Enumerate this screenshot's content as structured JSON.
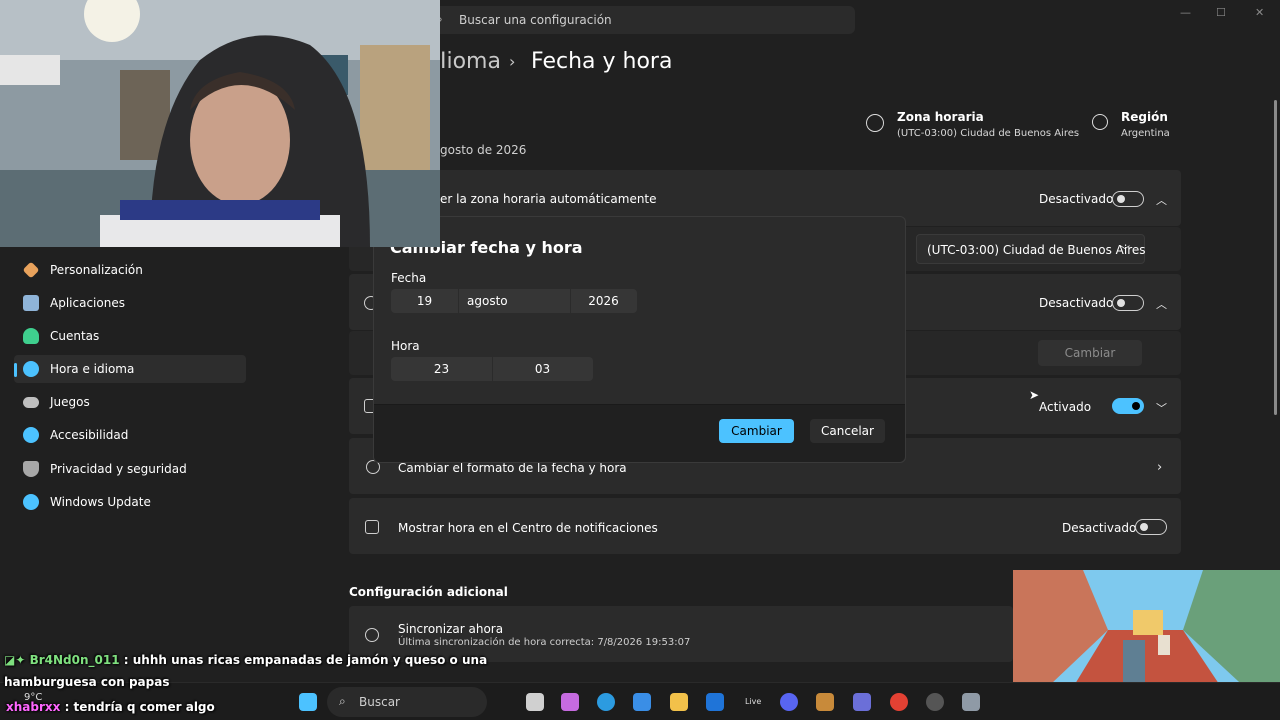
{
  "search": {
    "placeholder": "Buscar una configuración"
  },
  "window_controls": {
    "minimize": "—",
    "maximize": "☐",
    "close": "✕"
  },
  "breadcrumb": {
    "prev": "Iioma",
    "sep": "›",
    "current": "Fecha y hora"
  },
  "time_zone_info": {
    "title": "Zona horaria",
    "value": "(UTC-03:00) Ciudad de Buenos Aires"
  },
  "region_info": {
    "title": "Región",
    "value": "Argentina"
  },
  "current_date_text": "gosto de 2026",
  "settings": {
    "auto_timezone": {
      "label": "er la zona horaria automáticamente",
      "state": "Desactivado",
      "on": false
    },
    "timezone_dropdown": {
      "value": "(UTC-03:00) Ciudad de Buenos Aires"
    },
    "auto_time": {
      "state": "Desactivado",
      "on": false
    },
    "manual_change_button": "Cambiar",
    "dst": {
      "state": "Activado",
      "on": true
    },
    "format": {
      "label": "Cambiar el formato de la fecha y hora"
    },
    "notif": {
      "label": "Mostrar hora en el Centro de notificaciones",
      "state": "Desactivado",
      "on": false
    }
  },
  "additional": {
    "title": "Configuración adicional",
    "sync_title": "Sincronizar ahora",
    "sync_sub": "Última sincronización de hora correcta: 7/8/2026 19:53:07"
  },
  "sidebar": {
    "items": [
      {
        "label": "Personalización",
        "icon": "brush-icon",
        "color": "#e8a25c"
      },
      {
        "label": "Aplicaciones",
        "icon": "apps-icon",
        "color": "#8fb4d8"
      },
      {
        "label": "Cuentas",
        "icon": "person-icon",
        "color": "#3fcf8e"
      },
      {
        "label": "Hora e idioma",
        "icon": "globe-clock-icon",
        "color": "#4cc2ff",
        "selected": true
      },
      {
        "label": "Juegos",
        "icon": "gamepad-icon",
        "color": "#bfbfbf"
      },
      {
        "label": "Accesibilidad",
        "icon": "accessibility-icon",
        "color": "#4cc2ff"
      },
      {
        "label": "Privacidad y seguridad",
        "icon": "shield-icon",
        "color": "#a8a8a8"
      },
      {
        "label": "Windows Update",
        "icon": "refresh-icon",
        "color": "#4cc2ff"
      }
    ]
  },
  "dialog": {
    "title": "Cambiar fecha y hora",
    "date_label": "Fecha",
    "day": "19",
    "month": "agosto",
    "year": "2026",
    "time_label": "Hora",
    "hour": "23",
    "minute": "03",
    "confirm": "Cambiar",
    "cancel": "Cancelar"
  },
  "chat": {
    "line1_user": "Br4Nd0n_011",
    "line1_msg": ": uhhh unas ricas empanadas de jamón y queso o una",
    "line2_msg": "hamburguesa con papas",
    "line3_user": "xhabrxx",
    "line3_msg": ": tendría q comer algo",
    "weather": "9°C"
  },
  "taskbar": {
    "search_label": "Buscar",
    "live_label": "Live"
  },
  "colors": {
    "accent": "#4cc2ff",
    "background": "#202020",
    "card": "#2b2b2b"
  }
}
